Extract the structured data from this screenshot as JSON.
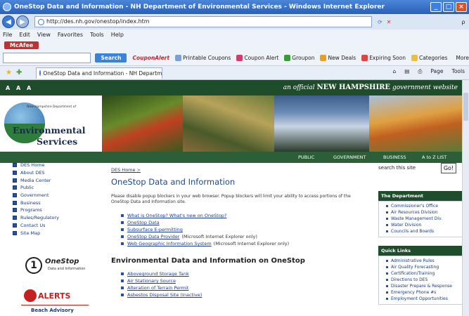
{
  "window": {
    "title": "OneStop Data and Information - NH Department of Environmental Services - Windows Internet Explorer",
    "minimize": "_",
    "maximize": "□",
    "close": "×"
  },
  "address": {
    "back": "◀",
    "forward": "▶",
    "url": "http://des.nh.gov/onestop/index.htm",
    "search_placeholder": "ρ"
  },
  "menu": [
    "File",
    "Edit",
    "View",
    "Favorites",
    "Tools",
    "Help"
  ],
  "mcafee": "McAfee",
  "toolbar": {
    "search_label": "Search",
    "coupon_brand": "CouponAlert",
    "items": [
      "Printable Coupons",
      "Coupon Alert",
      "Groupon",
      "New Deals",
      "Expiring Soon",
      "Categories",
      "More"
    ]
  },
  "tab": {
    "title": "OneStop Data and Information - NH Department of E...",
    "page_menu": "Page",
    "tools_menu": "Tools"
  },
  "site": {
    "font_size_letters": "A A A",
    "nh_pre": "an official",
    "nh_brand": "NEW HAMPSHIRE",
    "nh_post": "government website",
    "logo_small": "New Hampshire Department of",
    "logo_line1": "Environmental",
    "logo_line2": "Services",
    "top_nav": [
      "PUBLIC",
      "GOVERNMENT",
      "BUSINESS",
      "A to Z LIST"
    ],
    "left_nav": [
      "DES Home",
      "About DES",
      "Media Center",
      "Public",
      "Government",
      "Business",
      "Programs",
      "Rules/Regulatory",
      "Contact Us",
      "Site Map"
    ],
    "onestop_logo": "OneStop",
    "onestop_sub": "Data and Information",
    "alerts": "ALERTS",
    "beach": "Beach Advisory",
    "breadcrumb": "DES Home",
    "breadcrumb_sep": ">",
    "page_title": "OneStop Data and Information",
    "intro": "Please disable popup blockers in your web browser. Popup blockers will limit your ability to access portions of the OneStop Data and Information site.",
    "links": [
      {
        "text": "What is OneStop? What's new on OneStop?",
        "note": ""
      },
      {
        "text": "OneStop Data",
        "note": ""
      },
      {
        "text": "Subsurface E-permitting",
        "note": ""
      },
      {
        "text": "OneStop Data Provider",
        "note": "(Microsoft Internet Explorer only)"
      },
      {
        "text": "Web Geographic Information System",
        "note": "(Microsoft Internet Explorer only)"
      }
    ],
    "section_title": "Environmental Data and Information on OneStop",
    "links2": [
      "Aboveground Storage Tank",
      "Air Stationary Source",
      "Alteration of Terrain Permit",
      "Asbestos Disposal Site (Inactive)"
    ],
    "site_search_label": "search this site",
    "go": "Go!",
    "dept_head": "The Department",
    "dept_items": [
      "Commissioner's Office",
      "Air Resources Division",
      "Waste Management Div.",
      "Water Division",
      "Councils and Boards"
    ],
    "quick_head": "Quick Links",
    "quick_items": [
      "Administrative Rules",
      "Air Quality Forecasting",
      "Certification/Training",
      "Directions to DES",
      "Disaster Prepare & Response",
      "Emergency Phone #s",
      "Employment Opportunities"
    ]
  }
}
